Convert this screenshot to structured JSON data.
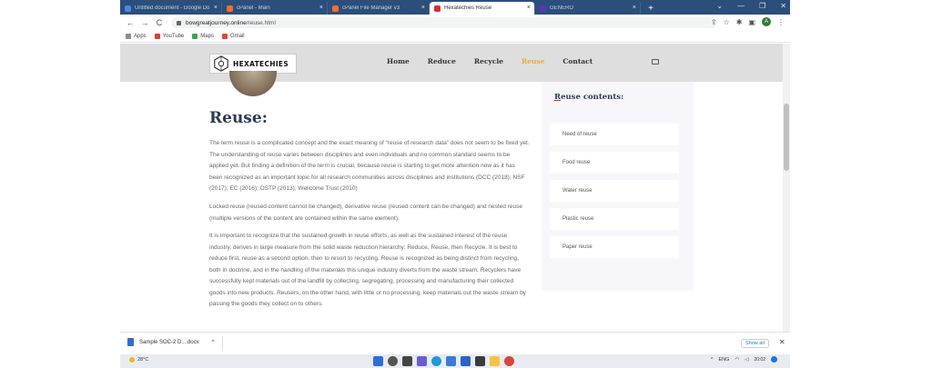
{
  "tabs": [
    {
      "label": "Untitled document - Google Do",
      "color": "#4a86e8"
    },
    {
      "label": "cPanel - Main",
      "color": "#ff6c2c"
    },
    {
      "label": "cPanel File Manager v3",
      "color": "#ff6c2c"
    },
    {
      "label": "Hexatechies Reuse",
      "color": "#d32f2f",
      "active": true
    },
    {
      "label": "GENERO",
      "color": "#5e35b1"
    }
  ],
  "tab_close": "×",
  "new_tab": "+",
  "window_controls": {
    "minimize": "—",
    "restore": "❐",
    "close": "✕",
    "dropdown": "⌄"
  },
  "address": {
    "host": "bowgreatjourney.online",
    "path": "/reuse.html"
  },
  "nav_buttons": {
    "back": "←",
    "forward": "→",
    "reload": "C"
  },
  "addr_icons": {
    "share": "⇪",
    "star": "☆",
    "extensions": "✱",
    "sidepanel": "▣",
    "menu": "⋮"
  },
  "profile_initial": "A",
  "bookmarks": [
    {
      "label": "Apps",
      "color": "#8b8b8b"
    },
    {
      "label": "YouTube",
      "color": "#e53935"
    },
    {
      "label": "Maps",
      "color": "#34a853"
    },
    {
      "label": "Gmail",
      "color": "#ea4335"
    }
  ],
  "site": {
    "brand": "HEXATECHIES",
    "nav": [
      "Home",
      "Reduce",
      "Recycle",
      "Reuse",
      "Contact"
    ],
    "active_nav": "Reuse",
    "heading": "Reuse:",
    "paragraphs": [
      "The term reuse is a complicated concept and the exact meaning of “reuse of research data” does not seem to be fixed yet. The understanding of reuse varies between disciplines and even individuals and no common standard seems to be applied yet. But finding a definition of the term is crucial, because reuse is starting to get more attention now as it has been recognized as an important topic for all research communities across disciplines and institutions (DCC (2018); NSF (2017); EC (2016); OSTP (2013); Wellcome Trust (2010)",
      "Locked reuse (reused content cannot be changed), derivative reuse (reused content can be changed) and nested reuse (multiple versions of the content are contained within the same element).",
      "It is important to recognize that the sustained growth in reuse efforts, as well as the sustained interest of the reuse industry, derives in large measure from the solid waste reduction hierarchy: Reduce, Reuse, then Recycle. It is best to reduce first, reuse as a second option, then to resort to recycling. Reuse is recognized as being distinct from recycling, both in doctrine, and in the handling of the materials this unique industry diverts from the waste stream. Recyclers have successfully kept materials out of the landfill by collecting, segregating, processing and manufacturing their collected goods into new products. Reusers, on the other hand, with little or no processing, keep materials out the waste stream by passing the goods they collect on to others."
    ],
    "aside_title_first": "R",
    "aside_title_rest": "euse contents:",
    "aside_items": [
      "Need of reuse",
      "Food reuse",
      "Water reuse",
      "Plastic reuse",
      "Paper reuse"
    ]
  },
  "downloads": {
    "file": "Sample SOC-2 D....docx",
    "caret": "^",
    "show_all": "Show all",
    "close": "✕"
  },
  "taskbar": {
    "weather": "28°C",
    "lang": "ENG",
    "time": "20:02",
    "tray_caret": "^"
  },
  "colors": {
    "accent_nav": "#f2a73b",
    "heading": "#2c3a55",
    "tab_bar": "#2b4f7a"
  }
}
